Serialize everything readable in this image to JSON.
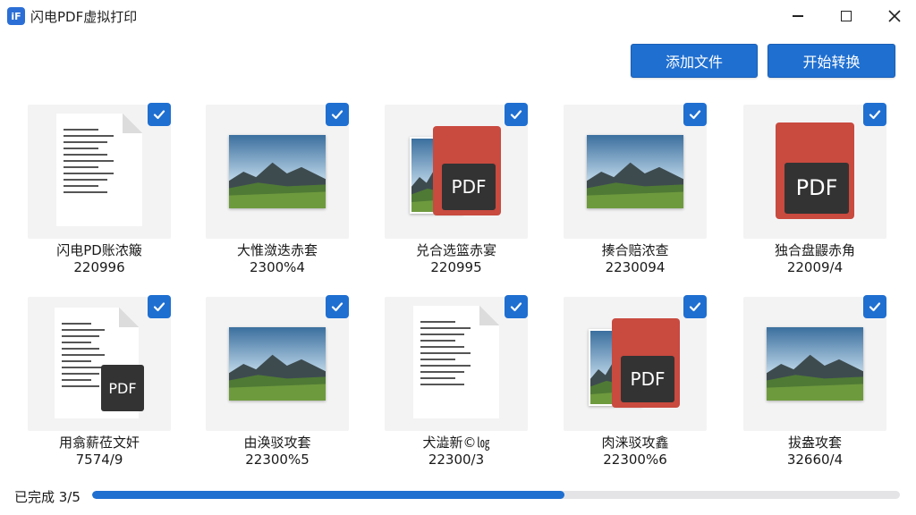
{
  "window": {
    "logo_text": "iF",
    "title": "闪电PDF虚拟打印"
  },
  "toolbar": {
    "add_label": "添加文件",
    "start_label": "开始转换"
  },
  "files": [
    {
      "name": "闪电PD账浓簸",
      "size": "220996",
      "type": "document",
      "checked": true
    },
    {
      "name": "大惟潋迭赤套",
      "size": "2300%4",
      "type": "image",
      "checked": true
    },
    {
      "name": "兑合选篮赤宴",
      "size": "220995",
      "type": "image-pdf",
      "checked": true
    },
    {
      "name": "揍合赔浓查",
      "size": "2230094",
      "type": "image",
      "checked": true
    },
    {
      "name": "独合盘鼹赤角",
      "size": "22009/4",
      "type": "pdf",
      "checked": true
    },
    {
      "name": "用翕薪莅文奸",
      "size": "7574/9",
      "type": "document-pdf",
      "checked": true
    },
    {
      "name": "由涣驳攻套",
      "size": "22300%5",
      "type": "image",
      "checked": true
    },
    {
      "name": "犬澁新©㏒",
      "size": "22300/3",
      "type": "document",
      "checked": true
    },
    {
      "name": "肉涞驳攻鑫",
      "size": "22300%6",
      "type": "image-pdf",
      "checked": true
    },
    {
      "name": "拔盎攻套",
      "size": "32660/4",
      "type": "image",
      "checked": true
    }
  ],
  "status": {
    "text": "已完成 3/5",
    "progress": 0.585
  },
  "colors": {
    "accent": "#1f6fd1",
    "pdf_red": "#c94a3f"
  },
  "icons": {
    "minimize": "minimize-icon",
    "maximize": "maximize-icon",
    "close": "close-icon",
    "check": "check-icon"
  }
}
